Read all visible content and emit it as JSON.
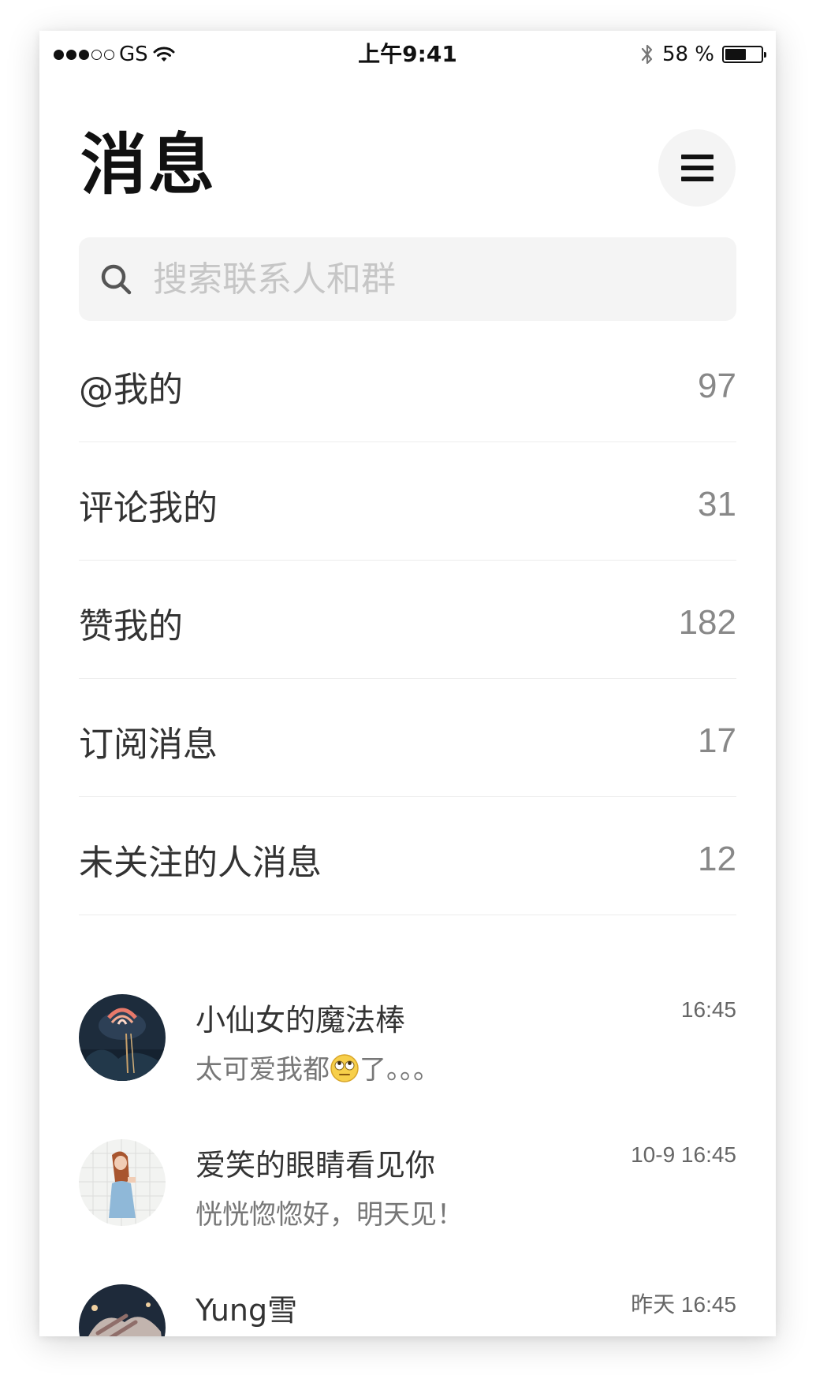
{
  "status_bar": {
    "carrier": "GS",
    "time": "上午9:41",
    "battery_text": "58 %",
    "battery_level_percent": 58
  },
  "header": {
    "title": "消息"
  },
  "search": {
    "placeholder": "搜索联系人和群"
  },
  "categories": [
    {
      "label": "@我的",
      "count": "97"
    },
    {
      "label": "评论我的",
      "count": "31"
    },
    {
      "label": "赞我的",
      "count": "182"
    },
    {
      "label": "订阅消息",
      "count": "17"
    },
    {
      "label": "未关注的人消息",
      "count": "12"
    }
  ],
  "conversations": [
    {
      "name": "小仙女的魔法棒",
      "time": "16:45",
      "message_before_emoji": "太可爱我都",
      "emoji": "rolling-eyes-emoji",
      "message_after_emoji": "了。。。"
    },
    {
      "name": "爱笑的眼睛看见你",
      "time": "10-9 16:45",
      "message": "恍恍惚惚好，明天见！"
    },
    {
      "name": "Yung雪",
      "time": "昨天 16:45"
    }
  ],
  "icons": {
    "signal": "signal-dots-icon",
    "wifi": "wifi-icon",
    "bluetooth": "bluetooth-icon",
    "battery": "battery-icon",
    "menu": "hamburger-menu-icon",
    "search": "search-icon"
  },
  "colors": {
    "background": "#ffffff",
    "search_bg": "#f4f4f4",
    "menu_button_bg": "#f4f4f4",
    "title": "#111111",
    "secondary_text": "#888888",
    "divider": "#ececec"
  }
}
